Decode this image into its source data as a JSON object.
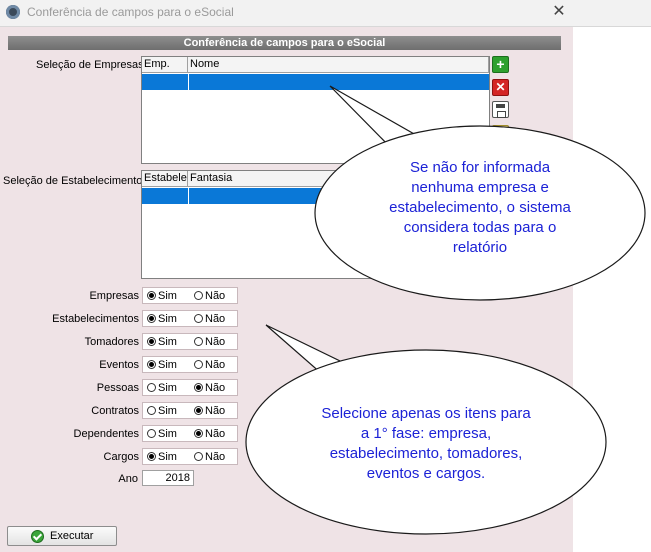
{
  "window": {
    "title": "Conferência de campos para o eSocial",
    "close_glyph": "✕"
  },
  "panel": {
    "header": "Conferência de campos para o eSocial"
  },
  "empresas_grid": {
    "label": "Seleção de Empresas",
    "columns": [
      "Emp.",
      "Nome"
    ]
  },
  "estab_grid": {
    "label": "Seleção de Estabelecimentos",
    "columns": [
      "Estabelec",
      "Fantasia"
    ]
  },
  "side_buttons": {
    "add": "+",
    "delete": "✕"
  },
  "options": {
    "yes_label": "Sim",
    "no_label": "Não",
    "rows": [
      {
        "label": "Empresas",
        "value": "Sim"
      },
      {
        "label": "Estabelecimentos",
        "value": "Sim"
      },
      {
        "label": "Tomadores",
        "value": "Sim"
      },
      {
        "label": "Eventos",
        "value": "Sim"
      },
      {
        "label": "Pessoas",
        "value": "Não"
      },
      {
        "label": "Contratos",
        "value": "Não"
      },
      {
        "label": "Dependentes",
        "value": "Não"
      },
      {
        "label": "Cargos",
        "value": "Sim"
      }
    ]
  },
  "ano": {
    "label": "Ano",
    "value": "2018"
  },
  "execute_button": {
    "label": "Executar"
  },
  "callouts": {
    "top": [
      "Se não for informada",
      "nenhuma empresa e",
      "estabelecimento, o sistema",
      "considera todas para o",
      "relatório"
    ],
    "bottom": [
      "Selecione apenas os itens para",
      "a 1° fase: empresa,",
      "estabelecimento, tomadores,",
      "eventos e cargos."
    ]
  },
  "colors": {
    "callout_text": "#1c22d6",
    "selection": "#0a78d7",
    "background": "#efe3e6"
  }
}
